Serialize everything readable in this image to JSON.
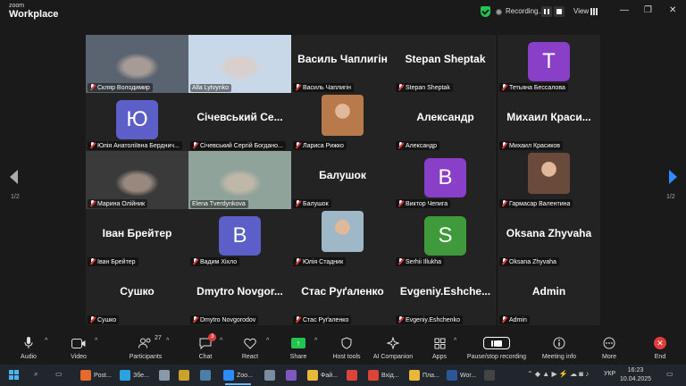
{
  "app": {
    "brand_top": "zoom",
    "brand_bottom": "Workplace",
    "recording_label": "Recording...",
    "view_label": "View",
    "minimize": "—",
    "maximize": "❐",
    "close": "✕"
  },
  "page_left": "1/2",
  "page_right": "1/2",
  "tiles": [
    {
      "id": "sklyar",
      "kind": "video",
      "label": "Скляр Володимир",
      "mic_muted": true,
      "bg": "#5a6470"
    },
    {
      "id": "alla",
      "kind": "video",
      "label": "Alla Lytvynko",
      "mic_muted": false,
      "bg": "#c9d8e8"
    },
    {
      "id": "vasyl",
      "kind": "name",
      "label": "Василь Чаплигін",
      "big": "Василь Чаплигін",
      "mic_muted": true
    },
    {
      "id": "stepan",
      "kind": "name",
      "label": "Stepan Sheptak",
      "big": "Stepan Sheptak",
      "mic_muted": true
    },
    {
      "id": "tetyana",
      "kind": "avatar",
      "label": "Тетьяна Бессалова",
      "letter": "T",
      "avatar_color": "#8a3fc8",
      "mic_muted": true
    },
    {
      "id": "yulia-b",
      "kind": "avatar",
      "label": "Юлія Анатоліївна Берднич...",
      "letter": "Ю",
      "avatar_color": "#5b5fc7",
      "mic_muted": true
    },
    {
      "id": "sichevsky",
      "kind": "name",
      "label": "Січевський Сергій Богдано...",
      "big": "Січевський Се...",
      "mic_muted": true
    },
    {
      "id": "larysa",
      "kind": "photo",
      "label": "Лариса Рижко",
      "bg": "#b87a4a",
      "mic_muted": true
    },
    {
      "id": "oleksandr",
      "kind": "name",
      "label": "Александр",
      "big": "Александр",
      "mic_muted": true
    },
    {
      "id": "mykhail",
      "kind": "name",
      "label": "Михаил Красиков",
      "big": "Михаил Краси...",
      "mic_muted": true
    },
    {
      "id": "maryna",
      "kind": "video",
      "label": "Марина Олійник",
      "mic_muted": true,
      "bg": "#3a3a3a"
    },
    {
      "id": "elena",
      "kind": "video",
      "label": "Elena Tverdynkova",
      "mic_muted": false,
      "bg": "#8fa39a",
      "speaking": true
    },
    {
      "id": "balushok",
      "kind": "name",
      "label": "Балушок",
      "big": "Балушок",
      "mic_muted": true
    },
    {
      "id": "viktor",
      "kind": "avatar",
      "label": "Виктор Чепига",
      "letter": "B",
      "avatar_color": "#8a3fc8",
      "mic_muted": true
    },
    {
      "id": "garmasar",
      "kind": "photo",
      "label": "Гармасар Валентина",
      "bg": "#6a4a3a",
      "mic_muted": true
    },
    {
      "id": "ivan",
      "kind": "name",
      "label": "Іван Брейтер",
      "big": "Іван Брейтер",
      "mic_muted": true
    },
    {
      "id": "vadym",
      "kind": "avatar",
      "label": "Вадим Хіхло",
      "letter": "B",
      "avatar_color": "#5b5fc7",
      "mic_muted": true
    },
    {
      "id": "yulia-s",
      "kind": "photo",
      "label": "Юлія Стадник",
      "bg": "#9fb8c8",
      "mic_muted": true
    },
    {
      "id": "serhii",
      "kind": "avatar",
      "label": "Serhii Illukha",
      "letter": "S",
      "avatar_color": "#3e9a3a",
      "mic_muted": true
    },
    {
      "id": "oksana",
      "kind": "name",
      "label": "Oksana Zhyvaha",
      "big": "Oksana Zhyvaha",
      "mic_muted": true
    },
    {
      "id": "sushko",
      "kind": "name",
      "label": "Сушко",
      "big": "Сушко",
      "mic_muted": true
    },
    {
      "id": "dmytro",
      "kind": "name",
      "label": "Dmytro Novgorodov",
      "big": "Dmytro  Novgor...",
      "mic_muted": true
    },
    {
      "id": "stas",
      "kind": "name",
      "label": "Стас Руґаленко",
      "big": "Стас Руґаленко",
      "mic_muted": true
    },
    {
      "id": "evgeniy",
      "kind": "name",
      "label": "Evgeniy.Eshchenko",
      "big": "Evgeniy.Eshche...",
      "mic_muted": true
    },
    {
      "id": "admin",
      "kind": "name",
      "label": "Admin",
      "big": "Admin",
      "mic_muted": true
    }
  ],
  "toolbar": {
    "audio": "Audio",
    "video": "Video",
    "participants": "Participants",
    "participants_count": "27",
    "chat": "Chat",
    "chat_badge": "3",
    "react": "React",
    "share": "Share",
    "host_tools": "Host tools",
    "ai_companion": "AI Companion",
    "apps": "Apps",
    "pause_stop": "Pause/stop recording",
    "meeting_info": "Meeting info",
    "more": "More",
    "end": "End"
  },
  "taskbar": {
    "items": [
      {
        "label": "Post...",
        "color": "#e66a2c"
      },
      {
        "label": "Збе...",
        "color": "#2aa3e0"
      },
      {
        "label": "",
        "color": "#8899aa"
      },
      {
        "label": "",
        "color": "#c9a227"
      },
      {
        "label": "",
        "color": "#4c7ea8"
      },
      {
        "label": "Zoo...",
        "color": "#2d8cff"
      },
      {
        "label": "",
        "color": "#7a8ca0"
      },
      {
        "label": "",
        "color": "#7e57c2"
      },
      {
        "label": "Фай...",
        "color": "#e8b83a"
      },
      {
        "label": "",
        "color": "#db4437"
      },
      {
        "label": "Вхід...",
        "color": "#db4437"
      },
      {
        "label": "Пла...",
        "color": "#e8b83a"
      },
      {
        "label": "Wor...",
        "color": "#2b5797"
      },
      {
        "label": "",
        "color": "#444"
      }
    ],
    "lang": "УКР",
    "time": "16:23",
    "date": "10.04.2025"
  }
}
